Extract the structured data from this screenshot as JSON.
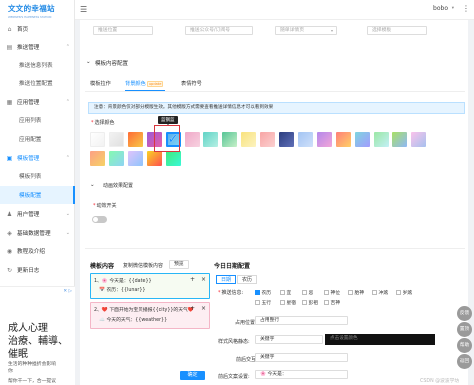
{
  "brand": {
    "title": "文文的幸福站",
    "subtitle": "WENWEN'S HAPPINESS STATION"
  },
  "header": {
    "collapse_icon": "☰",
    "user": "bobo",
    "user_caret": "▾",
    "menu_icon": "⋮"
  },
  "sidebar": {
    "items": [
      {
        "label": "首页",
        "icon": "⌂"
      },
      {
        "label": "推送管理",
        "icon": "▤",
        "arrow": "⌃"
      },
      {
        "label": "推送信息列表"
      },
      {
        "label": "推送位置配置"
      },
      {
        "label": "应用管理",
        "icon": "▦",
        "arrow": "⌃"
      },
      {
        "label": "应用列表"
      },
      {
        "label": "应用配置"
      },
      {
        "label": "模板管理",
        "icon": "▣",
        "arrow": "⌃"
      },
      {
        "label": "模板列表"
      },
      {
        "label": "模板配置"
      },
      {
        "label": "用户管理",
        "icon": "♟",
        "arrow": "⌄"
      },
      {
        "label": "基础数据管理",
        "icon": "◈",
        "arrow": "⌄"
      },
      {
        "label": "教程及介绍",
        "icon": "◉"
      },
      {
        "label": "更新日志",
        "icon": "↻"
      }
    ],
    "ad": {
      "mark": "✕ ▷",
      "lines": [
        "成人心理",
        "治療、輔導、",
        "催眠"
      ],
      "small": [
        "生活的种种挫折会影响",
        "你",
        "帮你干一下，合一提议"
      ]
    }
  },
  "filters": {
    "placeholders": [
      "推送位置",
      "推送公众号/订阅号",
      "随单详情页",
      "选择模板"
    ]
  },
  "section": {
    "title": "模板内容配置",
    "collapse_icon": "⌄"
  },
  "tabs": [
    {
      "label": "模板拉作",
      "active": false
    },
    {
      "label": "背景颜色",
      "active": true,
      "badge": "update"
    },
    {
      "label": "表情符号",
      "active": false
    }
  ],
  "notice": "注意：背景颜色仅对部分模版生效。其他模版方式需要查看推送详情信息才可以看到效果",
  "color_label": "选择颜色",
  "tooltip": "蓝钢蓝",
  "palette": {
    "selected_index": 4,
    "check_icon": "✓",
    "swatches": [
      {
        "from": "#ffffff",
        "to": "#f2f2f2"
      },
      {
        "from": "#f2f2f2",
        "to": "#e0e0e0"
      },
      {
        "from": "#ff6b35",
        "to": "#f7c948"
      },
      {
        "from": "#9b59d6",
        "to": "#e85fa6"
      },
      {
        "from": "#5aaeea",
        "to": "#7fd3f5"
      },
      {
        "from": "#f0a8c8",
        "to": "#f7d2e0"
      },
      {
        "from": "#5fd3c6",
        "to": "#b6f0e4"
      },
      {
        "from": "#56c596",
        "to": "#c7f0c8"
      },
      {
        "from": "#f9e27d",
        "to": "#fcf3c0"
      },
      {
        "from": "#f8a5a5",
        "to": "#fbd1d1"
      },
      {
        "from": "#2c3e7f",
        "to": "#5f6fb8"
      },
      {
        "from": "#a3c4f3",
        "to": "#cfe0fa"
      },
      {
        "from": "#b388eb",
        "to": "#f3a6d8"
      },
      {
        "from": "#ff7e79",
        "to": "#ffd166"
      },
      {
        "from": "#7ed6df",
        "to": "#a29bfe"
      },
      {
        "from": "#9be7a3",
        "to": "#c3f0f7"
      },
      {
        "from": "#a8e063",
        "to": "#8fb8f8"
      },
      {
        "from": "#fbc2eb",
        "to": "#a6c1ee"
      },
      {
        "from": "#fda085",
        "to": "#f6d365"
      },
      {
        "from": "#84fab0",
        "to": "#8fd3f4"
      },
      {
        "from": "#e0c3fc",
        "to": "#8ec5fc"
      },
      {
        "from": "#f9d423",
        "to": "#ff4e50"
      },
      {
        "from": "#43e97b",
        "to": "#38f9d7"
      }
    ]
  },
  "effects": {
    "title": "动画效果配置",
    "collapse_icon": "⌄",
    "switch_label": "动效开关",
    "switch_on": false
  },
  "template_content": {
    "title": "模板内容",
    "copy_link": "复制微信模板内容",
    "preview": "预览",
    "cards": [
      {
        "line1": "1、🌸 今天是：{{date}}",
        "line2": "📅 农历：{{lunar}}",
        "add": "+",
        "close": "×"
      },
      {
        "line1": "2、❤️ 下面开始为宝贝播报{{city}}的天气❤️",
        "line2": "☁️ 今天的天气：{{weather}}",
        "add": "+",
        "close": "×"
      }
    ],
    "confirm": "确定"
  },
  "today_config": {
    "title": "今日日期配置",
    "tabs": [
      {
        "label": "日期",
        "on": true
      },
      {
        "label": "农历",
        "on": false
      }
    ],
    "info_label": "推送信息:",
    "options": [
      {
        "label": "农历",
        "checked": true
      },
      {
        "label": "宜",
        "checked": false
      },
      {
        "label": "忌",
        "checked": false
      },
      {
        "label": "神位",
        "checked": false
      },
      {
        "label": "胎神",
        "checked": false
      },
      {
        "label": "冲煞",
        "checked": false
      },
      {
        "label": "岁煞",
        "checked": false
      },
      {
        "label": "五行",
        "checked": false
      },
      {
        "label": "星宿",
        "checked": false
      },
      {
        "label": "彭祖",
        "checked": false
      },
      {
        "label": "吉神",
        "checked": false
      }
    ],
    "position_label": "占用位置:",
    "position_value": "占用整行",
    "style_label": "样式风格静态:",
    "style_value": "关键字",
    "style_dark": "点击设置颜色",
    "title_label": "前后交互:",
    "title_value": "关键字",
    "preview_label": "前后文案设置:",
    "preview_value": "🌸 今天是："
  },
  "float_buttons": [
    "反馈",
    "置顶",
    "帮助",
    "返回"
  ],
  "watermark": "CSDN @波波学坊"
}
